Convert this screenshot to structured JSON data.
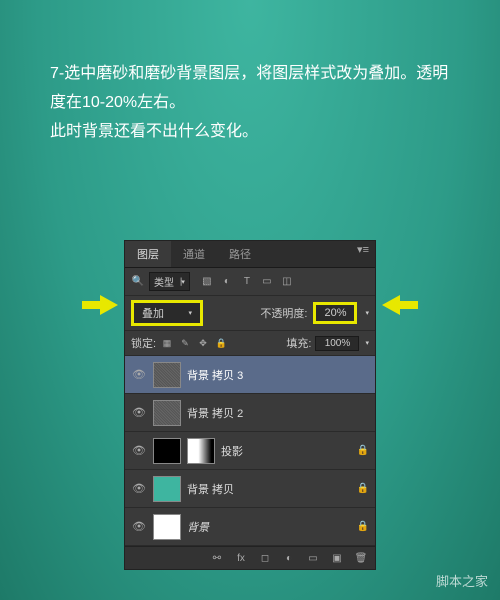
{
  "instruction": {
    "line1": "7-选中磨砂和磨砂背景图层，将图层样式改为叠加。透明度在10-20%左右。",
    "line2": "此时背景还看不出什么变化。"
  },
  "tabs": {
    "layers": "图层",
    "channels": "通道",
    "paths": "路径"
  },
  "filter": {
    "type_label": "类型"
  },
  "blend": {
    "mode": "叠加",
    "opacity_label": "不透明度:",
    "opacity_value": "20%"
  },
  "lock": {
    "label": "锁定:",
    "fill_label": "填充:",
    "fill_value": "100%"
  },
  "layers": [
    {
      "name": "背景 拷贝 3",
      "locked": false,
      "selected": true,
      "thumb": "noise"
    },
    {
      "name": "背景 拷贝 2",
      "locked": false,
      "selected": false,
      "thumb": "noise"
    },
    {
      "name": "投影",
      "locked": true,
      "selected": false,
      "thumb": "black",
      "mask": true
    },
    {
      "name": "背景 拷贝",
      "locked": true,
      "selected": false,
      "thumb": "teal"
    },
    {
      "name": "背景",
      "locked": true,
      "selected": false,
      "thumb": "white",
      "italic": true
    }
  ],
  "watermark": "脚本之家"
}
